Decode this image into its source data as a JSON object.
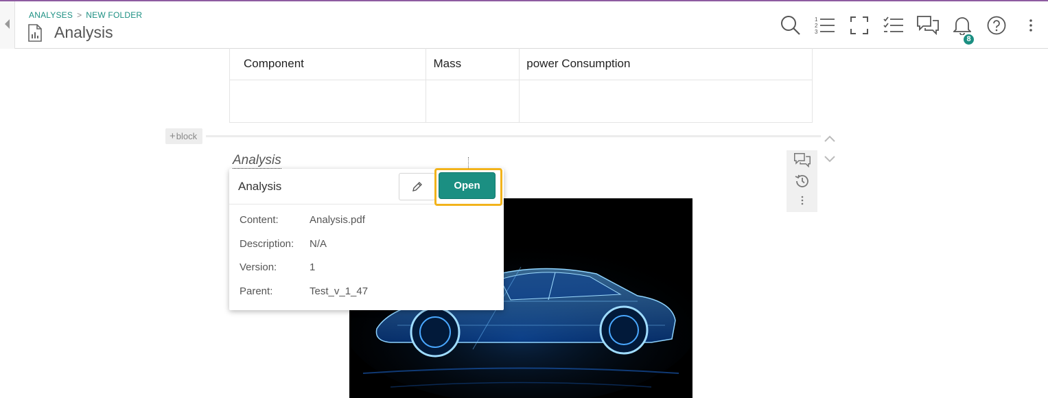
{
  "header": {
    "breadcrumb": [
      "ANALYSES",
      "NEW FOLDER"
    ],
    "title": "Analysis",
    "toolbar": [
      "search-icon",
      "numbered-list-icon",
      "fullscreen-icon",
      "checklist-icon",
      "comments-icon",
      "bell-icon",
      "help-icon",
      "more-vertical-icon"
    ],
    "notification_count": "8"
  },
  "table": {
    "columns": [
      "Component",
      "Mass",
      "power Consumption"
    ],
    "rows": [
      [
        "",
        "",
        ""
      ]
    ]
  },
  "block": {
    "add_label": "block",
    "link_text": "Analysis"
  },
  "popup": {
    "title": "Analysis",
    "open_label": "Open",
    "properties": [
      {
        "label": "Content:",
        "value": "Analysis.pdf"
      },
      {
        "label": "Description:",
        "value": "N/A"
      },
      {
        "label": "Version:",
        "value": "1"
      },
      {
        "label": "Parent:",
        "value": "Test_v_1_47"
      }
    ]
  },
  "colors": {
    "accent": "#1b8f82",
    "highlight": "#f2b31b",
    "top_border": "#8e5ba1"
  }
}
